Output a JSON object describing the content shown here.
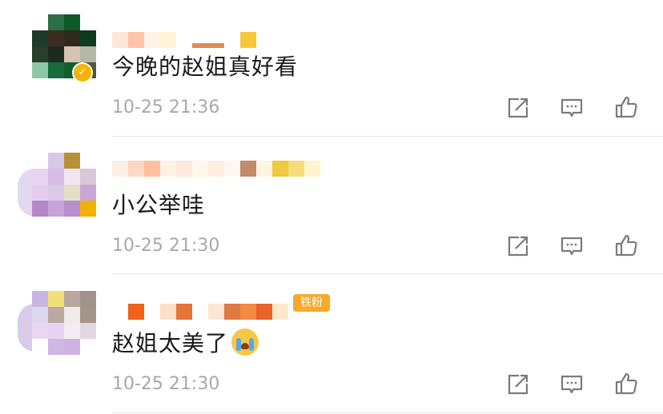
{
  "comments": [
    {
      "text": "今晚的赵姐真好看",
      "timestamp": "10-25 21:36",
      "verified": true,
      "avatar_colors": [
        "#ffffff",
        "#2a6f45",
        "#0d5a25",
        "#ffffff",
        "#1f3b28",
        "#3a2e22",
        "#2d2a1c",
        "#0e3b1e",
        "#2a3e2c",
        "#1e2a20",
        "#d8c2b0",
        "#b5b5a8",
        "#8cc8a8",
        "#1a6b3c",
        "#10602c",
        "#4b5a3c"
      ]
    },
    {
      "text": "小公举哇",
      "timestamp": "10-25 21:30",
      "verified": false,
      "avatar_colors": [
        "#ffffff",
        "#d9c8ea",
        "#b7913a",
        "#ffffff",
        "#e7d3f2",
        "#d6bde6",
        "#f1e6f0",
        "#d8c7d8",
        "#e5cfee",
        "#dcc8e8",
        "#e4dfc9",
        "#c9a7d4",
        "#b387c9",
        "#c7a4d8",
        "#b98ecd",
        "#f4b100"
      ]
    },
    {
      "text": "赵姐太美了",
      "timestamp": "10-25 21:30",
      "verified": false,
      "fan_badge": "铁粉",
      "has_cry_emoji": true,
      "avatar_colors": [
        "#c8b6e0",
        "#f1e07a",
        "#b8a8a0",
        "#a0938a",
        "#ddd8ee",
        "#b9a9a2",
        "#f0eceb",
        "#a39589",
        "#e8d7ef",
        "#e8d2f2",
        "#f2ecf2",
        "#e1d7e1",
        "#ffffff",
        "#cfb6e5",
        "#cdb2e2",
        "#ffffff"
      ]
    }
  ],
  "actions": {
    "share_icon": "share-icon",
    "comment_icon": "comment-icon",
    "like_icon": "thumbs-up-icon"
  },
  "colors": {
    "text": "#1a1a1a",
    "timestamp": "#a8a8a8",
    "icon": "#7a7a7a",
    "verified": "#f6b300",
    "fan_badge": "#f7a928"
  }
}
